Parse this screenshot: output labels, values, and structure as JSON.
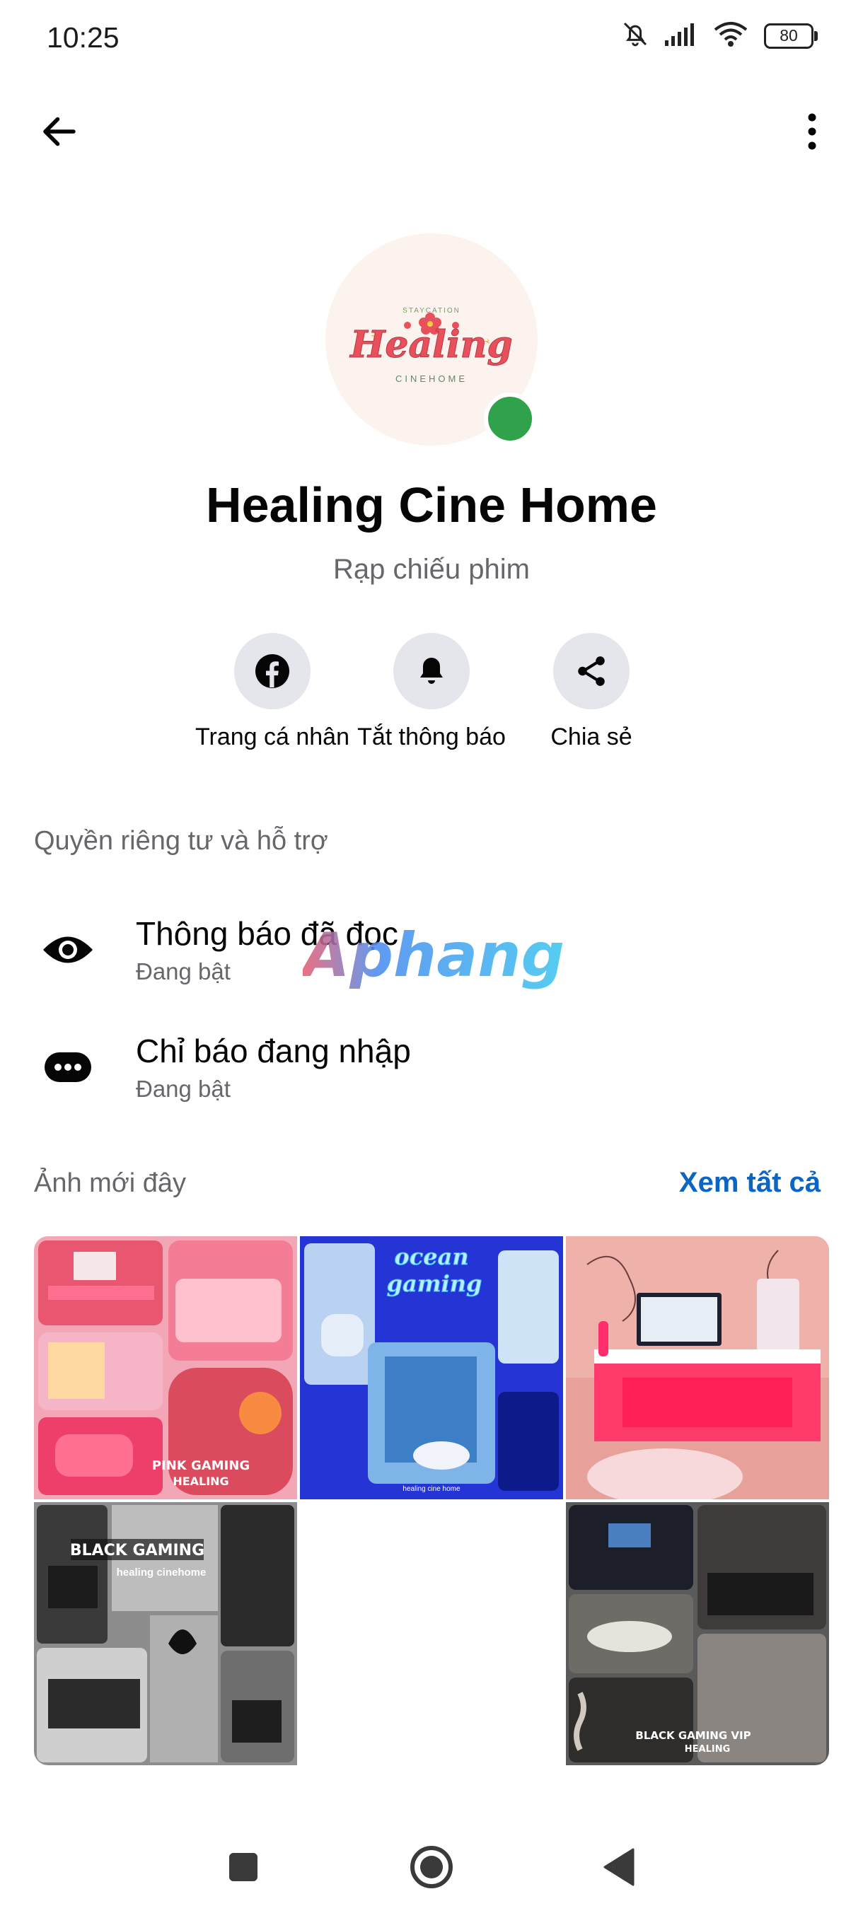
{
  "status_bar": {
    "time": "10:25",
    "battery": "80",
    "icons": [
      "bell-off-icon",
      "signal-icon",
      "wifi-icon",
      "battery-icon"
    ]
  },
  "top_bar": {
    "back_icon": "arrow-left-icon",
    "menu_icon": "more-vertical-icon"
  },
  "profile": {
    "logo_text": "Healing",
    "logo_subtext": "CINEHOME",
    "logo_arc_text": "STAYCATION",
    "name": "Healing Cine Home",
    "category": "Rạp chiếu phim",
    "online": true,
    "online_color": "#31a24c"
  },
  "actions": [
    {
      "label": "Trang cá nhân",
      "icon": "facebook-icon"
    },
    {
      "label": "Tắt thông báo",
      "icon": "bell-icon"
    },
    {
      "label": "Chia sẻ",
      "icon": "share-icon"
    }
  ],
  "privacy": {
    "title": "Quyền riêng tư và hỗ trợ",
    "items": [
      {
        "title": "Thông báo đã đọc",
        "subtitle": "Đang bật",
        "icon": "eye-icon"
      },
      {
        "title": "Chỉ báo đang nhập",
        "subtitle": "Đang bật",
        "icon": "typing-indicator-icon"
      }
    ]
  },
  "watermark": "Aphang",
  "photos": {
    "title": "Ảnh mới đây",
    "see_all": "Xem tất cả",
    "accent_color": "#0a66c2",
    "items": [
      {
        "caption": "PINK GAMING",
        "caption2": "HEALING"
      },
      {
        "caption": "ocean",
        "caption2": "gaming",
        "caption3": "healing cine home"
      },
      {
        "caption": ""
      },
      {
        "caption": "BLACK GAMING",
        "caption2": "healing cinehome"
      },
      {
        "caption": ""
      },
      {
        "caption": "BLACK GAMING VIP",
        "caption2": "HEALING"
      }
    ]
  },
  "nav_bar": {
    "icons": [
      "recents-square-icon",
      "home-circle-icon",
      "back-triangle-icon"
    ]
  }
}
